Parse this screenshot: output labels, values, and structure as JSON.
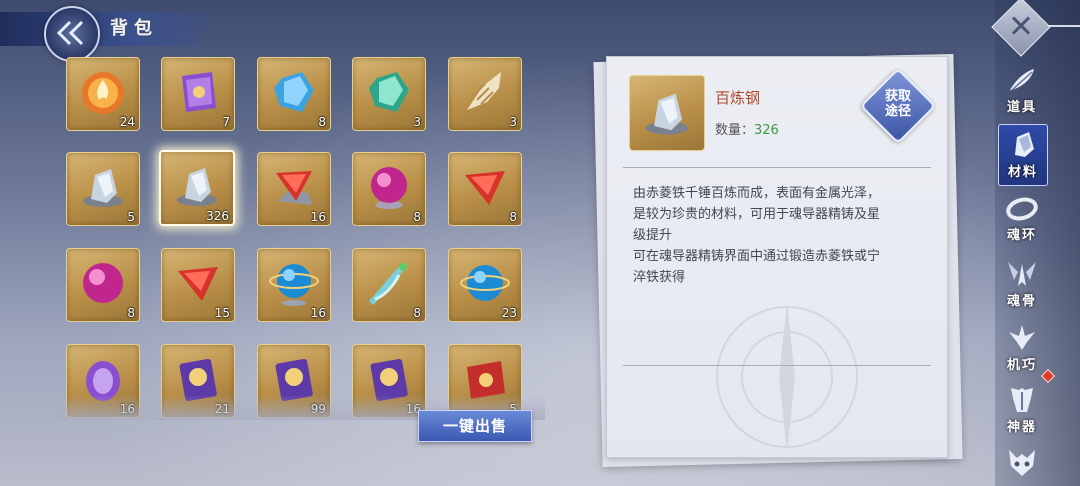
{
  "header": {
    "title": "背包",
    "back_icon": "chevron-double-left-icon"
  },
  "grid": {
    "items": [
      {
        "icon": "fire-orb-icon",
        "count": "24"
      },
      {
        "icon": "purple-scroll-icon",
        "count": "7"
      },
      {
        "icon": "blue-crystal-icon",
        "count": "8"
      },
      {
        "icon": "green-crystal-icon",
        "count": "3"
      },
      {
        "icon": "conch-shell-icon",
        "count": "3"
      },
      {
        "icon": "silver-ore-icon",
        "count": "5"
      },
      {
        "icon": "silver-ore-icon",
        "count": "326",
        "selected": true
      },
      {
        "icon": "red-gem-on-ore-icon",
        "count": "16"
      },
      {
        "icon": "pink-orb-on-stand-icon",
        "count": "8"
      },
      {
        "icon": "red-gem-icon",
        "count": "8"
      },
      {
        "icon": "pink-orb-icon",
        "count": "8"
      },
      {
        "icon": "red-gem-icon",
        "count": "15"
      },
      {
        "icon": "blue-ringed-orb-on-stand-icon",
        "count": "16"
      },
      {
        "icon": "feather-herb-icon",
        "count": "8"
      },
      {
        "icon": "blue-ringed-orb-icon",
        "count": "23"
      },
      {
        "icon": "purple-amulet-icon",
        "count": "16"
      },
      {
        "icon": "purple-card-icon",
        "count": "21"
      },
      {
        "icon": "purple-card-icon",
        "count": "99"
      },
      {
        "icon": "purple-card-icon",
        "count": "16"
      },
      {
        "icon": "red-scroll-icon",
        "count": "5"
      }
    ]
  },
  "sell_button": "一键出售",
  "detail": {
    "name": "百炼钢",
    "qty_label": "数量：",
    "qty_value": "326",
    "source_line1": "获取",
    "source_line2": "途径",
    "desc_line1": "由赤菱铁千锤百炼而成，表面有金属光泽，",
    "desc_line2": "是较为珍贵的材料，可用于魂导器精铸及星",
    "desc_line3": "级提升",
    "desc_line4": "可在魂导器精铸界面中通过锻造赤菱铁或宁",
    "desc_line5": "淬铁获得"
  },
  "sidebar": {
    "close_icon": "close-icon",
    "tabs": [
      {
        "label": "道具",
        "icon": "feather-icon"
      },
      {
        "label": "材料",
        "icon": "ore-icon",
        "active": true
      },
      {
        "label": "魂环",
        "icon": "ring-icon"
      },
      {
        "label": "魂骨",
        "icon": "bone-wings-icon"
      },
      {
        "label": "机巧",
        "icon": "mechanism-icon",
        "badge": true
      },
      {
        "label": "神器",
        "icon": "armor-icon"
      },
      {
        "label": "",
        "icon": "demon-mask-icon"
      }
    ]
  },
  "colors": {
    "accent": "#2f4aa8",
    "item_name": "#b14a2a",
    "qty_value": "#3a9a45",
    "badge": "#e03a2d"
  }
}
